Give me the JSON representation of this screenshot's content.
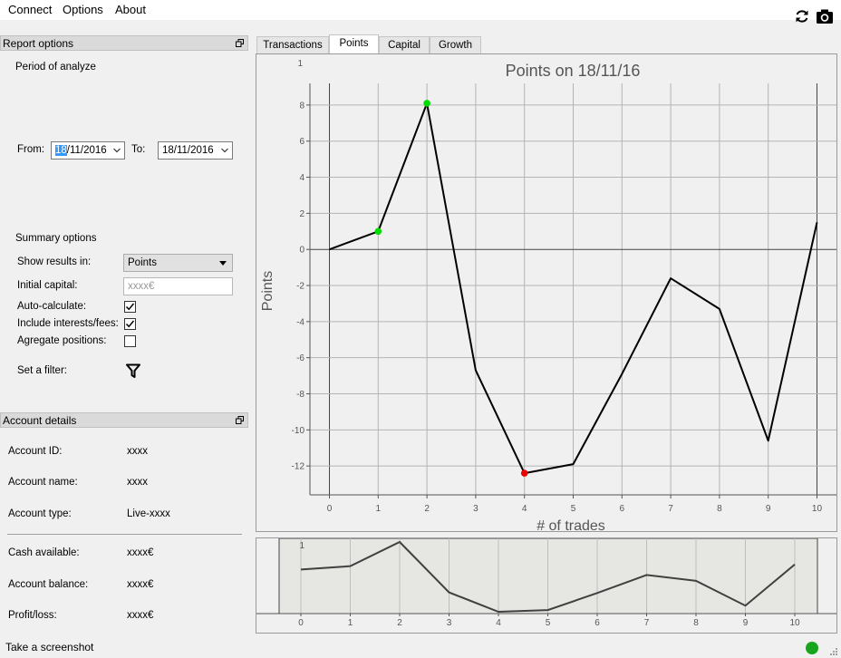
{
  "menu": {
    "connect": "Connect",
    "options": "Options",
    "about": "About"
  },
  "report_options": {
    "title": "Report options",
    "period_label": "Period of analyze",
    "from_label": "From:",
    "from_day": "18",
    "from_rest": "/11/2016",
    "to_label": "To:",
    "to_value": "18/11/2016",
    "summary_label": "Summary options",
    "show_results_label": "Show results in:",
    "show_results_value": "Points",
    "initial_capital_label": "Initial capital:",
    "initial_capital_placeholder": "xxxx€",
    "auto_calculate_label": "Auto-calculate:",
    "auto_calculate_checked": true,
    "include_interests_label": "Include interests/fees:",
    "include_interests_checked": true,
    "aggregate_label": "Agregate positions:",
    "aggregate_checked": false,
    "filter_label": "Set a filter:"
  },
  "account_details": {
    "title": "Account details",
    "account_id_label": "Account ID:",
    "account_id_value": "xxxx",
    "account_name_label": "Account name:",
    "account_name_value": "xxxx",
    "account_type_label": "Account type:",
    "account_type_value": "Live-xxxx",
    "cash_label": "Cash available:",
    "cash_value": "xxxx€",
    "balance_label": "Account balance:",
    "balance_value": "xxxx€",
    "pl_label": "Profit/loss:",
    "pl_value": "xxxx€"
  },
  "tabs": [
    {
      "label": "Transactions"
    },
    {
      "label": "Points"
    },
    {
      "label": "Capital"
    },
    {
      "label": "Growth"
    }
  ],
  "active_tab": 1,
  "footer": {
    "screenshot_label": "Take a screenshot",
    "status_color": "#16a51c"
  },
  "chart_data": {
    "type": "line",
    "title": "Points on 18/11/16",
    "xlabel": "# of trades",
    "ylabel": "Points",
    "x": [
      0,
      1,
      2,
      3,
      4,
      5,
      6,
      7,
      8,
      9,
      10
    ],
    "y": [
      0,
      1,
      8.1,
      -6.7,
      -12.4,
      -11.9,
      -6.9,
      -1.6,
      -3.3,
      -10.6,
      1.5
    ],
    "xlim": [
      -0.4,
      10.4
    ],
    "ylim": [
      -13.6,
      9.2
    ],
    "xticks": [
      0,
      1,
      2,
      3,
      4,
      5,
      6,
      7,
      8,
      9,
      10
    ],
    "yticks": [
      -12,
      -10,
      -8,
      -6,
      -4,
      -2,
      0,
      2,
      4,
      6,
      8
    ],
    "corner_tick": "1",
    "grid": true,
    "line_color": "#000000",
    "max_markers": [
      1,
      2
    ],
    "max_marker_color": "#00dd00",
    "min_markers": [
      4
    ],
    "min_marker_color": "#ee0000",
    "overview": {
      "corner_tick": "1",
      "line_color": "#404040",
      "region_color": "#e6e6e2"
    }
  }
}
